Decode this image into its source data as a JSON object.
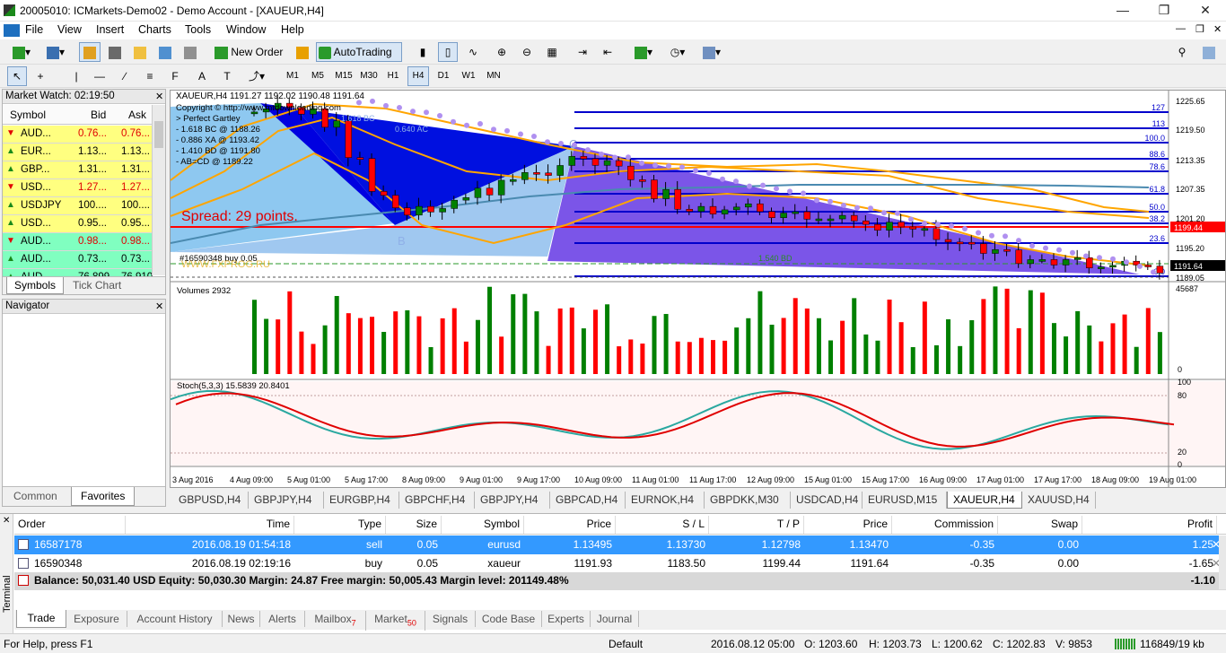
{
  "window": {
    "title": "20005010: ICMarkets-Demo02 - Demo Account - [XAUEUR,H4]"
  },
  "menu": [
    "File",
    "View",
    "Insert",
    "Charts",
    "Tools",
    "Window",
    "Help"
  ],
  "toolbar": {
    "new_order": "New Order",
    "autotrading": "AutoTrading",
    "periods": [
      "M1",
      "M5",
      "M15",
      "M30",
      "H1",
      "H4",
      "D1",
      "W1",
      "MN"
    ],
    "active_period": "H4"
  },
  "market_watch": {
    "title": "Market Watch: 02:19:50",
    "columns": [
      "Symbol",
      "Bid",
      "Ask"
    ],
    "rows": [
      {
        "symbol": "AUD...",
        "bid": "0.76...",
        "ask": "0.76...",
        "bg": "#ffff80",
        "dir": "down"
      },
      {
        "symbol": "EUR...",
        "bid": "1.13...",
        "ask": "1.13...",
        "bg": "#ffff80",
        "dir": "up"
      },
      {
        "symbol": "GBP...",
        "bid": "1.31...",
        "ask": "1.31...",
        "bg": "#ffff80",
        "dir": "up"
      },
      {
        "symbol": "USD...",
        "bid": "1.27...",
        "ask": "1.27...",
        "bg": "#ffff80",
        "dir": "down"
      },
      {
        "symbol": "USDJPY",
        "bid": "100....",
        "ask": "100....",
        "bg": "#ffff80",
        "dir": "up"
      },
      {
        "symbol": "USD...",
        "bid": "0.95...",
        "ask": "0.95...",
        "bg": "#ffff80",
        "dir": "up"
      },
      {
        "symbol": "AUD...",
        "bid": "0.98...",
        "ask": "0.98...",
        "bg": "#80ffc0",
        "dir": "down"
      },
      {
        "symbol": "AUD...",
        "bid": "0.73...",
        "ask": "0.73...",
        "bg": "#80ffc0",
        "dir": "up"
      },
      {
        "symbol": "AUD...",
        "bid": "76.899",
        "ask": "76.910",
        "bg": "#80ffc0",
        "dir": "up"
      }
    ],
    "tabs": [
      "Symbols",
      "Tick Chart"
    ]
  },
  "navigator": {
    "title": "Navigator",
    "tabs": [
      "Common",
      "Favorites"
    ]
  },
  "chart": {
    "header": "XAUEUR,H4  1191.27 1192.02 1190.48 1191.64",
    "info_lines": [
      "Copyright © http://www.mtdownloading.com",
      "> Perfect Gartley",
      "- 1.618 BC @ 1188.26",
      "- 0.886 XA @ 1193.42",
      "- 1.410 BD @ 1191.80",
      "- AB=CD @ 1189.22"
    ],
    "spread": "Spread: 29 points.",
    "order_line": "#16590348 buy 0.05",
    "watermark": "WWW.FXPROG.RU",
    "labels": {
      "c": "C",
      "b": "B",
      "bd": "1.540 BD",
      "ac": "0.640 AC",
      "bc": "1.618 BC"
    },
    "fib_levels": [
      "127",
      "113",
      "100.0",
      "88.6",
      "78.6",
      "61.8",
      "50.0",
      "38.2",
      "23.6",
      "0.0"
    ],
    "price_axis": [
      "1225.65",
      "1219.50",
      "1213.35",
      "1207.35",
      "1201.20",
      "1195.20",
      "1189.05"
    ],
    "tp_price": "1199.44",
    "current_price": "1191.64",
    "volumes_label": "Volumes 2932",
    "volume_axis": [
      "45687",
      "0"
    ],
    "stoch_label": "Stoch(5,3,3) 15.5839 20.8401",
    "stoch_axis": [
      "100",
      "80",
      "20",
      "0"
    ],
    "time_axis": [
      "3 Aug 2016",
      "4 Aug 09:00",
      "5 Aug 01:00",
      "5 Aug 17:00",
      "8 Aug 09:00",
      "9 Aug 01:00",
      "9 Aug 17:00",
      "10 Aug 09:00",
      "11 Aug 01:00",
      "11 Aug 17:00",
      "12 Aug 09:00",
      "15 Aug 01:00",
      "15 Aug 17:00",
      "16 Aug 09:00",
      "17 Aug 01:00",
      "17 Aug 17:00",
      "18 Aug 09:00",
      "19 Aug 01:00"
    ],
    "colors": {
      "up": "#008000",
      "down": "#ff0000",
      "bg_pattern": "#0000e0",
      "fib": "#0000cc",
      "tp": "#ff0000",
      "bands": "#ffa500"
    }
  },
  "chart_tabs": [
    "GBPUSD,H4",
    "GBPJPY,H4",
    "EURGBP,H4",
    "GBPCHF,H4",
    "GBPJPY,H4",
    "GBPCAD,H4",
    "EURNOK,H4",
    "GBPDKK,M30",
    "USDCAD,H4",
    "EURUSD,M15",
    "XAUEUR,H4",
    "XAUUSD,H4"
  ],
  "active_chart_tab": "XAUEUR,H4",
  "terminal": {
    "side_label": "Terminal",
    "columns": [
      "Order",
      "Time",
      "Type",
      "Size",
      "Symbol",
      "Price",
      "S / L",
      "T / P",
      "Price",
      "Commission",
      "Swap",
      "Profit"
    ],
    "rows": [
      {
        "order": "16587178",
        "time": "2016.08.19 01:54:18",
        "type": "sell",
        "size": "0.05",
        "symbol": "eurusd",
        "price": "1.13495",
        "sl": "1.13730",
        "tp": "1.12798",
        "cur": "1.13470",
        "commission": "-0.35",
        "swap": "0.00",
        "profit": "1.25",
        "selected": true
      },
      {
        "order": "16590348",
        "time": "2016.08.19 02:19:16",
        "type": "buy",
        "size": "0.05",
        "symbol": "xaueur",
        "price": "1191.93",
        "sl": "1183.50",
        "tp": "1199.44",
        "cur": "1191.64",
        "commission": "-0.35",
        "swap": "0.00",
        "profit": "-1.65",
        "selected": false
      }
    ],
    "balance_line": "Balance: 50,031.40 USD  Equity: 50,030.30  Margin: 24.87  Free margin: 50,005.43  Margin level: 201149.48%",
    "total_profit": "-1.10",
    "tabs": [
      {
        "label": "Trade"
      },
      {
        "label": "Exposure"
      },
      {
        "label": "Account History"
      },
      {
        "label": "News"
      },
      {
        "label": "Alerts"
      },
      {
        "label": "Mailbox",
        "badge": "7"
      },
      {
        "label": "Market",
        "badge": "50"
      },
      {
        "label": "Signals"
      },
      {
        "label": "Code Base"
      },
      {
        "label": "Experts"
      },
      {
        "label": "Journal"
      }
    ]
  },
  "status": {
    "help": "For Help, press F1",
    "profile": "Default",
    "time": "2016.08.12 05:00",
    "open": "O: 1203.60",
    "high": "H: 1203.73",
    "low": "L: 1200.62",
    "close": "C: 1202.83",
    "volume": "V: 9853",
    "traffic": "116849/19 kb"
  }
}
